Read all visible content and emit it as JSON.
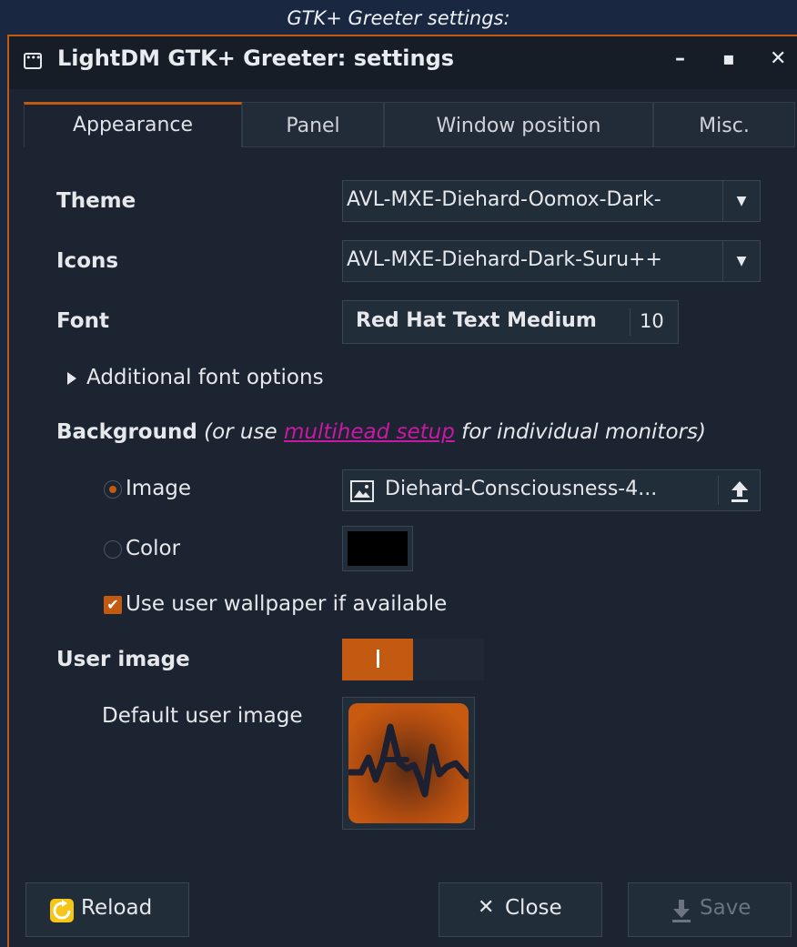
{
  "caption": "GTK+ Greeter settings:",
  "window": {
    "title": "LightDM GTK+ Greeter: settings",
    "controls": {
      "minimize": "–",
      "maximize": "▪",
      "close": "✕"
    }
  },
  "tabs": [
    {
      "label": "Appearance",
      "active": true
    },
    {
      "label": "Panel",
      "active": false
    },
    {
      "label": "Window position",
      "active": false
    },
    {
      "label": "Misc.",
      "active": false
    }
  ],
  "appearance": {
    "theme_label": "Theme",
    "theme_value": "AVL-MXE-Diehard-Oomox-Dark-",
    "icons_label": "Icons",
    "icons_value": "AVL-MXE-Diehard-Dark-Suru++",
    "font_label": "Font",
    "font_name": "Red Hat Text Medium",
    "font_size": "10",
    "additional_font_options": "Additional font options",
    "background_label": "Background",
    "background_note_pre": "(or use ",
    "background_note_link": "multihead setup",
    "background_note_post": " for individual monitors)",
    "image_option": "Image",
    "image_selected": true,
    "image_file": "Diehard-Consciousness-4...",
    "color_option": "Color",
    "color_value": "#000000",
    "use_wallpaper_label": "Use user wallpaper if available",
    "use_wallpaper_checked": true,
    "user_image_label": "User image",
    "user_image_enabled": true,
    "default_user_image_label": "Default user image"
  },
  "buttons": {
    "reload": "Reload",
    "close": "Close",
    "save": "Save"
  },
  "colors": {
    "accent": "#c35a12",
    "link": "#c818a4",
    "window_bg": "#1b2430"
  }
}
